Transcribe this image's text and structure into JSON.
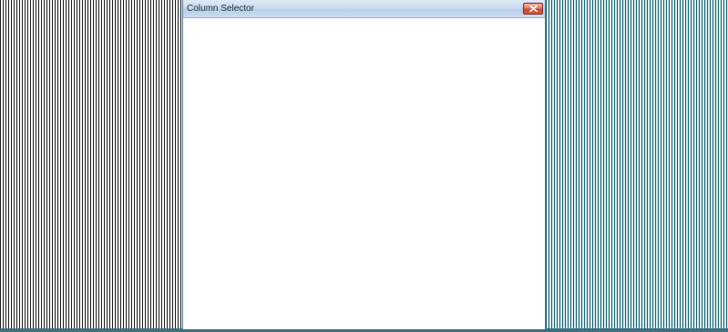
{
  "window": {
    "title": "Column Selector",
    "close_icon": "close-icon"
  },
  "colors": {
    "titlebar_top": "#dfeaf6",
    "titlebar_bottom": "#c9dcf0",
    "close_button": "#c9462e",
    "left_stripes": "#1b1b1b",
    "right_stripes": "#1d5f6f"
  }
}
